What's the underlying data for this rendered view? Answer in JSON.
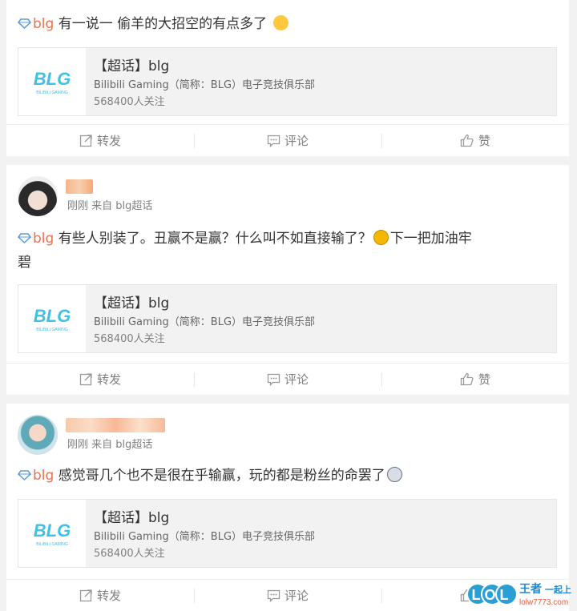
{
  "colors": {
    "accent": "#eb7350",
    "gray": "#808080",
    "card_bg": "#f2f2f2",
    "page_bg": "#f2f2f2"
  },
  "topic": "blg",
  "card": {
    "title": "【超话】blg",
    "desc": "Bilibili Gaming（简称：BLG）电子竞技俱乐部",
    "fans": "568400人关注",
    "logo_text": "BLG",
    "logo_sub": "BILIBILI GAMING"
  },
  "actions": {
    "repost": "转发",
    "comment": "评论",
    "like": "赞"
  },
  "posts": [
    {
      "meta": "",
      "text": "有一说一 偷羊的大招空的有点多了"
    },
    {
      "meta": "刚刚 来自 blg超话",
      "text": "有些人别装了。丑赢不是赢？什么叫不如直接输了？",
      "text_tail": "下一把加油牢",
      "text_line2": "碧"
    },
    {
      "meta": "刚刚 来自 blg超话",
      "text": "感觉哥几个也不是很在乎输赢，玩的都是粉丝的命罢了"
    }
  ],
  "watermark": {
    "logo": "LOL",
    "brand": "王者",
    "slogan": "一起上",
    "url": "lolw7773.com"
  }
}
